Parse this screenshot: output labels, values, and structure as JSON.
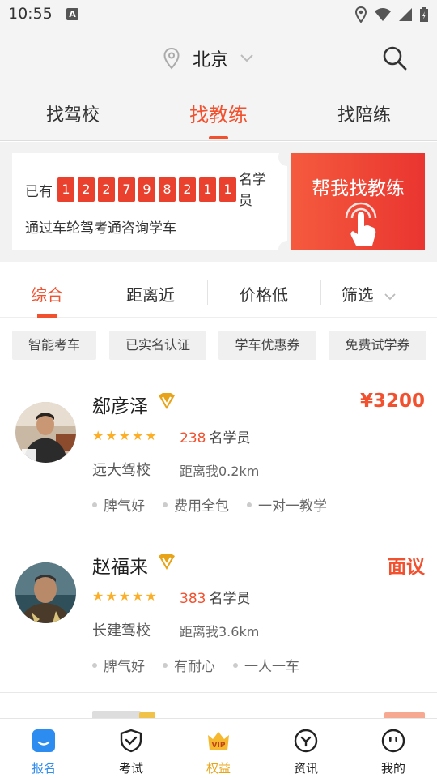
{
  "status_bar": {
    "time": "10:55",
    "a_icon": "A"
  },
  "header": {
    "city": "北京"
  },
  "top_tabs": [
    "找驾校",
    "找教练",
    "找陪练"
  ],
  "banner": {
    "prefix": "已有",
    "digits": [
      "1",
      "2",
      "2",
      "7",
      "9",
      "8",
      "2",
      "1",
      "1"
    ],
    "suffix": "名学员",
    "subtitle": "通过车轮驾考通咨询学车",
    "cta_label": "帮我找教练"
  },
  "filters": [
    "综合",
    "距离近",
    "价格低",
    "筛选"
  ],
  "chips": [
    "智能考车",
    "已实名认证",
    "学车优惠券",
    "免费试学券"
  ],
  "coaches": [
    {
      "name": "郄彦泽",
      "price": "¥3200",
      "rating": 5,
      "students": "238",
      "students_label": "名学员",
      "school": "远大驾校",
      "distance": "距离我0.2km",
      "tags": [
        "脾气好",
        "费用全包",
        "一对一教学"
      ]
    },
    {
      "name": "赵福来",
      "price": "面议",
      "rating": 5,
      "students": "383",
      "students_label": "名学员",
      "school": "长建驾校",
      "distance": "距离我3.6km",
      "tags": [
        "脾气好",
        "有耐心",
        "一人一车"
      ]
    }
  ],
  "bottom_nav": [
    {
      "label": "报名",
      "icon": "signup-icon",
      "active": true
    },
    {
      "label": "考试",
      "icon": "exam-shield-icon",
      "active": false
    },
    {
      "label": "权益",
      "icon": "vip-crown-icon",
      "active": false
    },
    {
      "label": "资讯",
      "icon": "news-icon",
      "active": false
    },
    {
      "label": "我的",
      "icon": "profile-icon",
      "active": false
    }
  ],
  "colors": {
    "accent": "#f2512f",
    "star": "#fbae26",
    "blue": "#2d8cf0",
    "gold": "#e8a418"
  }
}
